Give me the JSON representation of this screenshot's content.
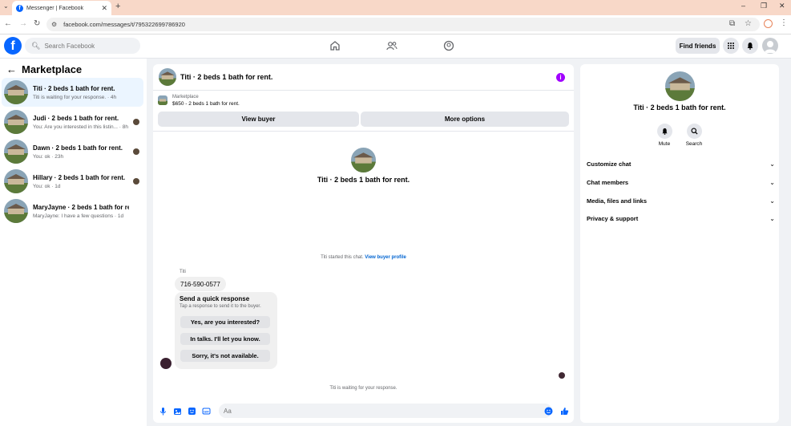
{
  "browser": {
    "tab_title": "Messenger | Facebook",
    "url": "facebook.com/messages/t/795322699786920"
  },
  "fb": {
    "search_placeholder": "Search Facebook",
    "find_friends": "Find friends"
  },
  "left": {
    "title": "Marketplace",
    "conversations": [
      {
        "name": "Titi · 2 beds 1 bath for rent.",
        "preview": "Titi is waiting for your response. · 4h",
        "active": true
      },
      {
        "name": "Judi · 2 beds 1 bath for rent.",
        "preview": "You: Are you interested in this listin... · 8h"
      },
      {
        "name": "Dawn · 2 beds 1 bath for rent.",
        "preview": "You: ok · 23h"
      },
      {
        "name": "Hillary · 2 beds 1 bath for rent.",
        "preview": "You: ok · 1d"
      },
      {
        "name": "MaryJayne · 2 beds 1 bath for rent.",
        "preview": "MaryJayne: I have a few questions · 1d"
      }
    ]
  },
  "chat": {
    "title": "Titi · 2 beds 1 bath for rent.",
    "marketplace_label": "Marketplace",
    "listing": "$650 - 2 beds 1 bath for rent.",
    "view_buyer": "View buyer",
    "more_options": "More options",
    "center_name": "Titi · 2 beds 1 bath for rent.",
    "started_text": "Titi started this chat.",
    "view_buyer_profile": "View buyer profile",
    "sender": "Titi",
    "phone": "716-590-0577",
    "quick_title": "Send a quick response",
    "quick_sub": "Tap a response to send it to the buyer.",
    "quick_1": "Yes, are you interested?",
    "quick_2": "In talks. I'll let you know.",
    "quick_3": "Sorry, it's not available.",
    "waiting": "Titi is waiting for your response.",
    "input_placeholder": "Aa"
  },
  "right": {
    "name": "Titi · 2 beds 1 bath for rent.",
    "mute": "Mute",
    "search": "Search",
    "rows": [
      "Customize chat",
      "Chat members",
      "Media, files and links",
      "Privacy & support"
    ]
  },
  "colors": {
    "accent": "#0866ff",
    "info": "#a100ff",
    "active_row": "#ebf5ff"
  }
}
